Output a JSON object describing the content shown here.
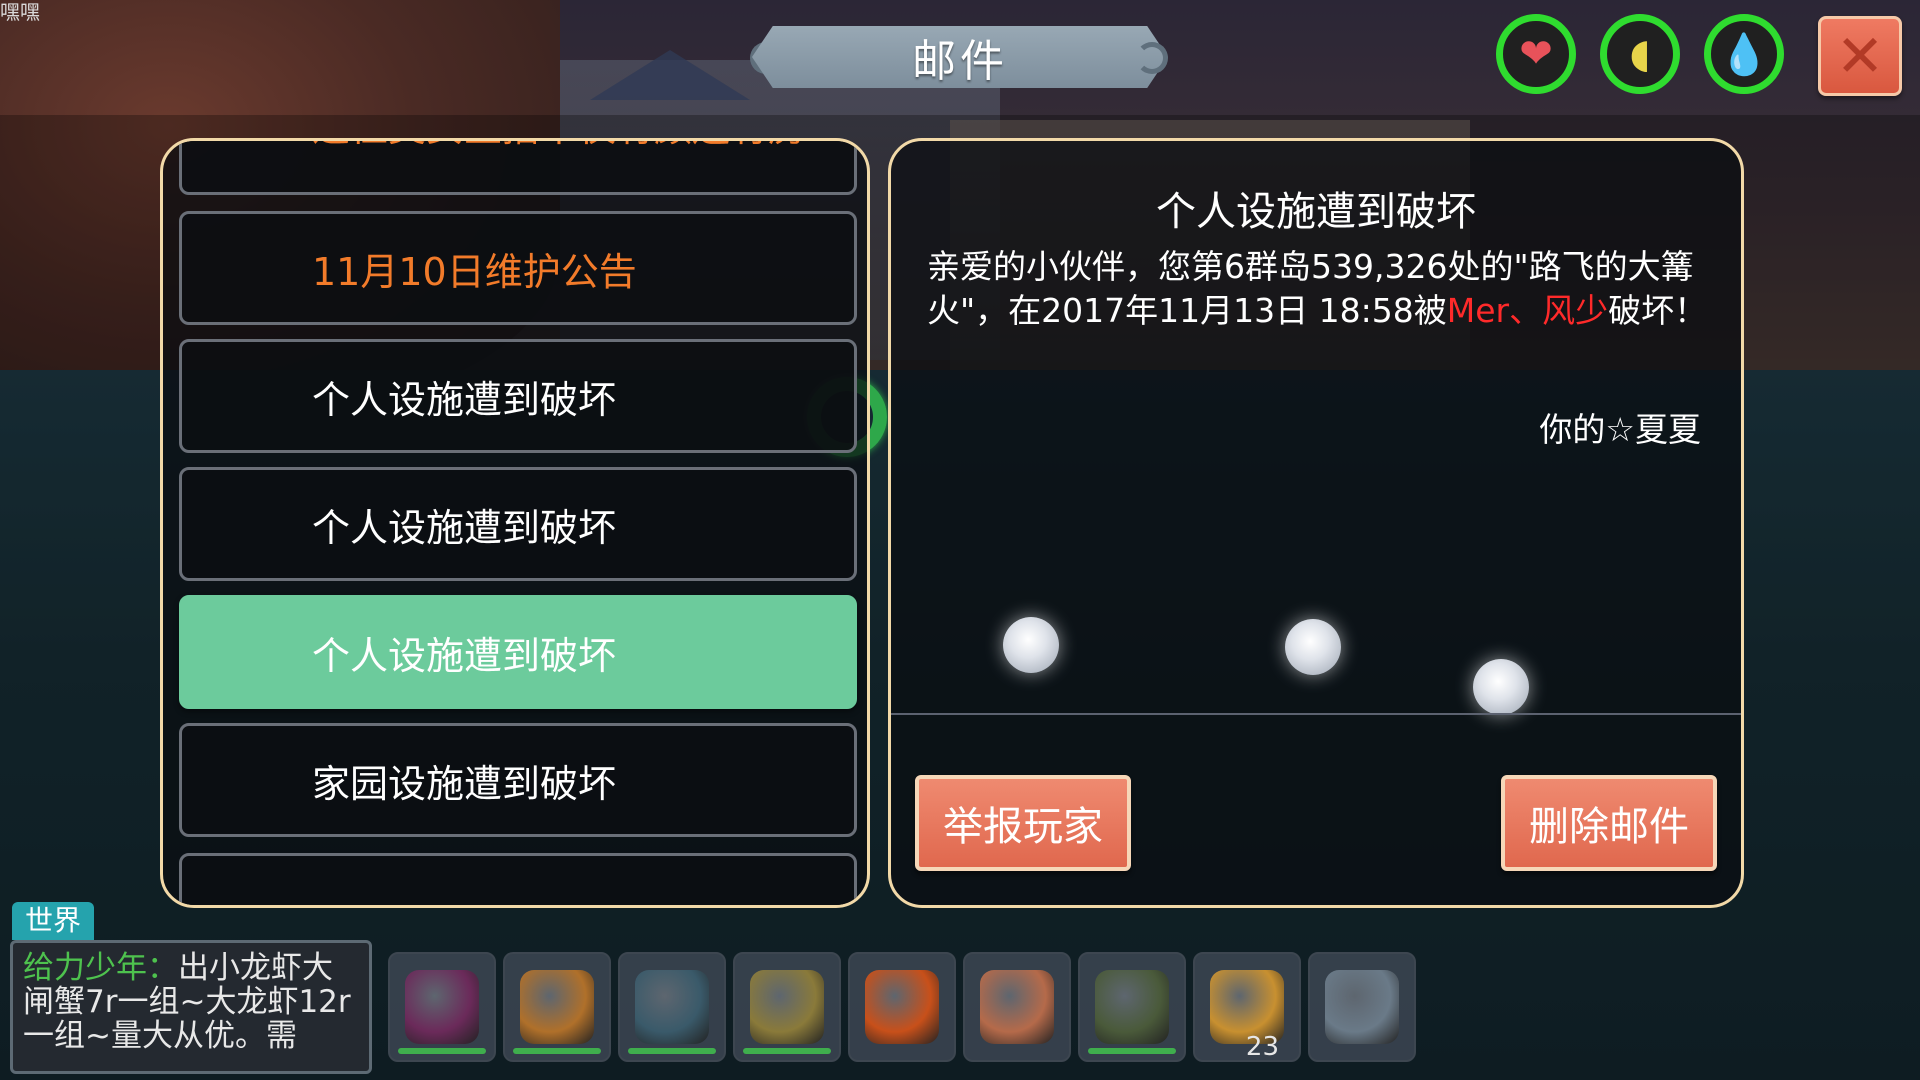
{
  "corner_text": "嘿嘿",
  "window": {
    "title": "邮件"
  },
  "mail_list": {
    "items": [
      {
        "label": "这位美女主播不仅有颜还有房",
        "style": "orange"
      },
      {
        "label": "11月10日维护公告",
        "style": "orange"
      },
      {
        "label": "个人设施遭到破坏",
        "style": "normal"
      },
      {
        "label": "个人设施遭到破坏",
        "style": "normal"
      },
      {
        "label": "个人设施遭到破坏",
        "style": "selected"
      },
      {
        "label": "家园设施遭到破坏",
        "style": "normal"
      }
    ]
  },
  "detail": {
    "title": "个人设施遭到破坏",
    "body_part1": "亲爱的小伙伴，您第6群岛539,326处的\"路飞的大篝火\"，在2017年11月13日 18:58被",
    "body_highlight": "Mer、风少",
    "body_part2": "破坏！",
    "signature": "你的☆夏夏",
    "report_button": "举报玩家",
    "delete_button": "删除邮件"
  },
  "status_icons": [
    {
      "name": "heart-icon",
      "glyph": "❤",
      "color": "#e8525a"
    },
    {
      "name": "food-icon",
      "glyph": "◖",
      "color": "#e8d44a"
    },
    {
      "name": "water-icon",
      "glyph": "💧",
      "color": "#2ab4ee"
    }
  ],
  "close_glyph": "✕",
  "chat": {
    "channel": "世界",
    "sender": "给力少年：",
    "message": "出小龙虾大闸蟹7r一组~大龙虾12r一组~量大从优。需"
  },
  "hotbar": [
    {
      "name": "scythe-icon",
      "color": "#6b2a5a",
      "bar": true,
      "count": ""
    },
    {
      "name": "gourd-icon",
      "color": "#b0702a",
      "bar": true,
      "count": ""
    },
    {
      "name": "staff-icon",
      "color": "#3a5a6a",
      "bar": true,
      "count": ""
    },
    {
      "name": "bow-icon",
      "color": "#8a7a3a",
      "bar": true,
      "count": ""
    },
    {
      "name": "campfire-icon",
      "color": "#c8501a",
      "bar": false,
      "count": ""
    },
    {
      "name": "boat-icon",
      "color": "#b56a4a",
      "bar": false,
      "count": ""
    },
    {
      "name": "pickaxe-icon",
      "color": "#4a5a3a",
      "bar": true,
      "count": ""
    },
    {
      "name": "pie-icon",
      "color": "#c89030",
      "bar": false,
      "count": "23"
    },
    {
      "name": "stone-icon",
      "color": "#6a7a88",
      "bar": false,
      "count": ""
    }
  ]
}
